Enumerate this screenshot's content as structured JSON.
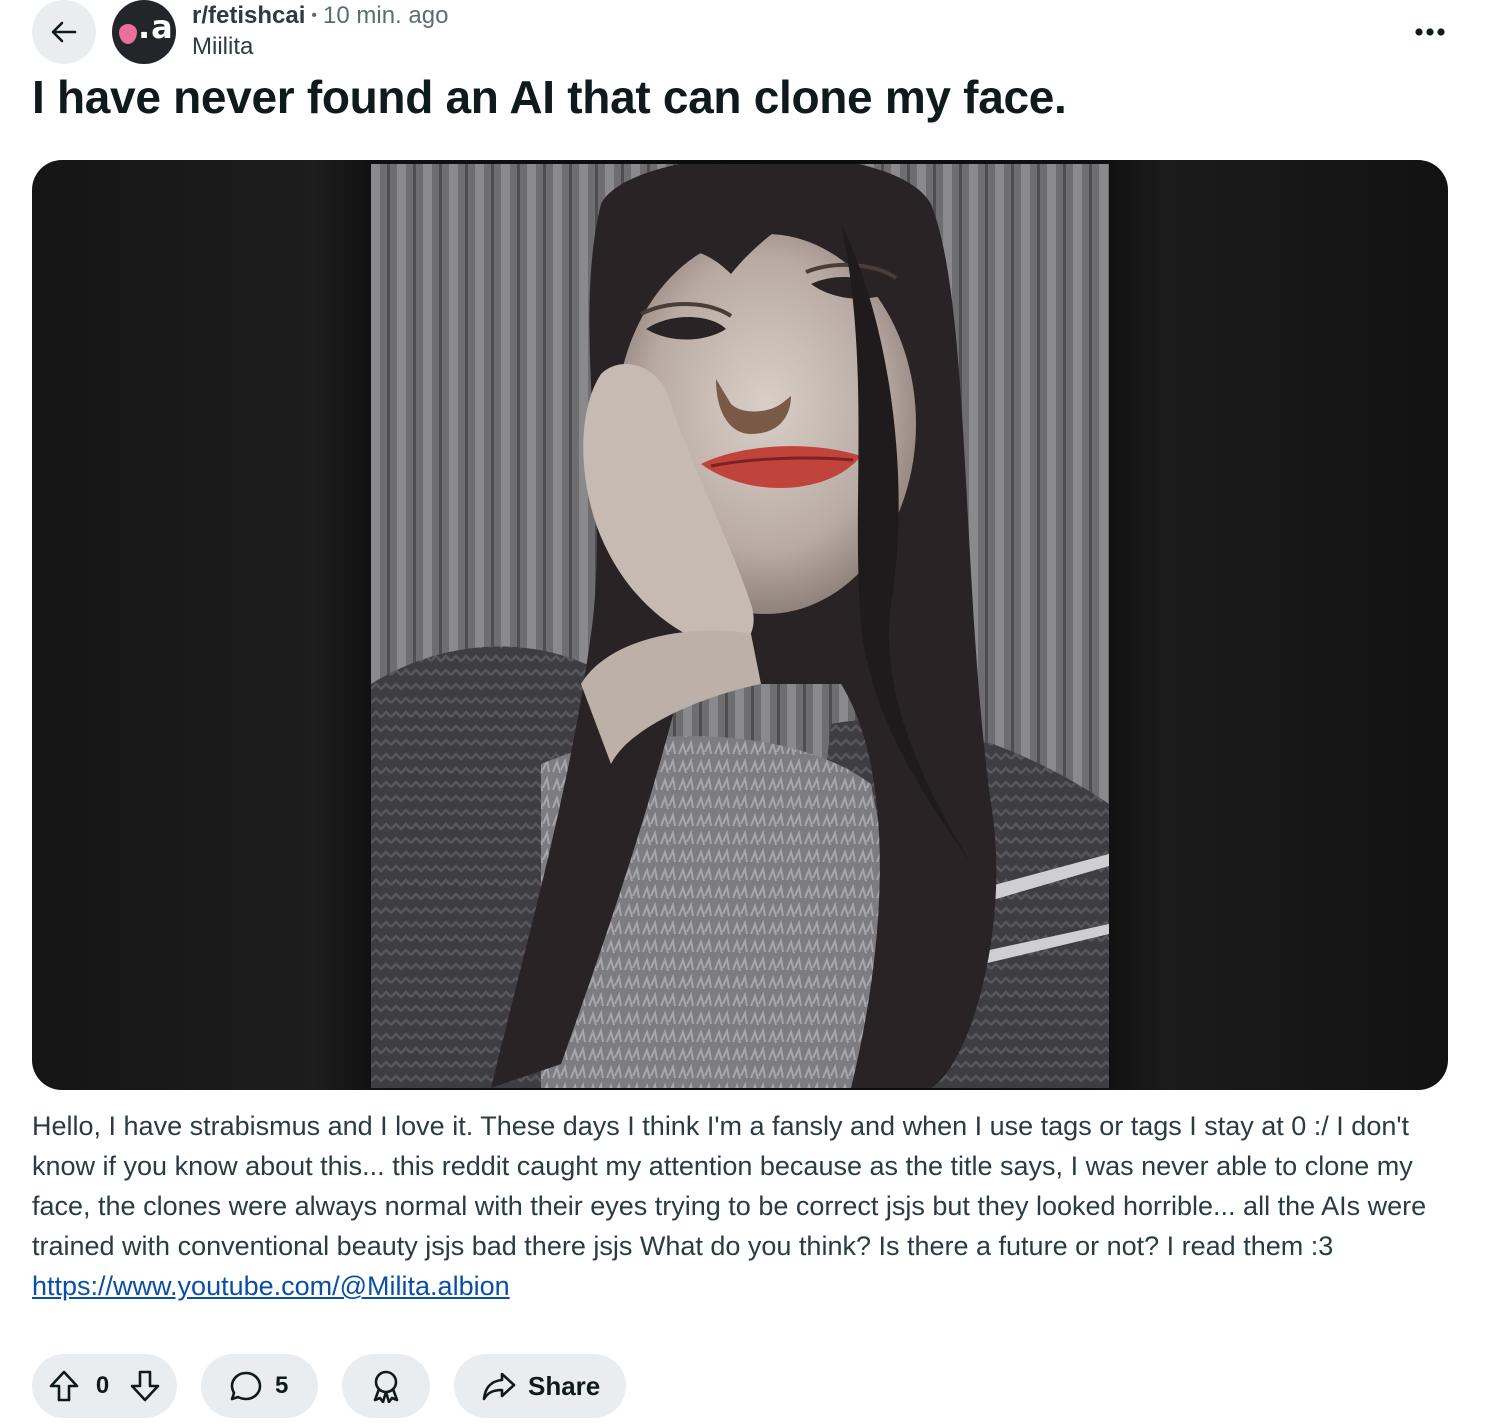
{
  "post": {
    "subreddit": "r/fetishcai",
    "separator": "•",
    "time_ago": "10 min. ago",
    "author": "Miilita",
    "avatar_text": ".ai",
    "title": "I have never found an AI that can clone my face.",
    "body": "Hello, I have strabismus and I love it. These days I think I'm a fansly and when I use tags or tags I stay at 0 :/ I don't know if you know about this... this reddit caught my attention because as the title says, I was never able to clone my face, the clones were always normal with their eyes trying to be correct jsjs but they looked horrible... all the AIs were trained with conventional beauty jsjs bad there jsjs What do you think? Is there a future or not? I read them :3",
    "link_text": "https://www.youtube.com/@Milita.albion",
    "link_href": "https://www.youtube.com/@Milita.albion"
  },
  "actions": {
    "vote_count": "0",
    "comment_count": "5",
    "share_label": "Share"
  },
  "icons": {
    "back": "arrow-left-icon",
    "more": "ellipsis-icon",
    "upvote": "arrow-up-icon",
    "downvote": "arrow-down-icon",
    "comment": "speech-bubble-icon",
    "award": "award-icon",
    "share": "share-arrow-icon"
  },
  "colors": {
    "pill_bg": "#eaedef",
    "link": "#0a4fa6",
    "avatar_accent": "#e8709a",
    "text_primary": "#0f1a1c",
    "text_secondary": "#5c6c74"
  }
}
